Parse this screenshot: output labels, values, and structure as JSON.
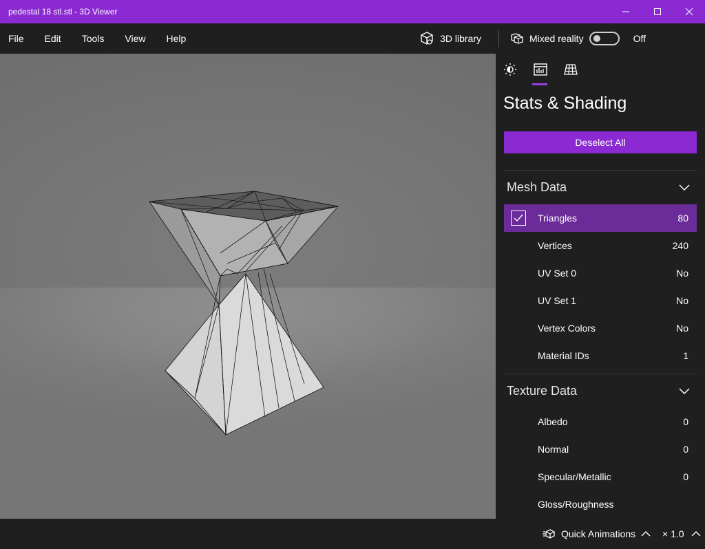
{
  "window": {
    "title": "pedestal 18 stl.stl - 3D Viewer",
    "controls": [
      "minimize",
      "maximize",
      "close"
    ]
  },
  "menu": {
    "items": [
      "File",
      "Edit",
      "Tools",
      "View",
      "Help"
    ],
    "library_label": "3D library",
    "mixed_reality_label": "Mixed reality",
    "mixed_reality_state": "Off"
  },
  "panel": {
    "tabs": [
      {
        "icon": "lighting-icon",
        "active": false
      },
      {
        "icon": "stats-icon",
        "active": true
      },
      {
        "icon": "grid-icon",
        "active": false
      }
    ],
    "title": "Stats & Shading",
    "deselect_label": "Deselect All",
    "mesh": {
      "title": "Mesh Data",
      "rows": [
        {
          "label": "Triangles",
          "value": "80",
          "selected": true
        },
        {
          "label": "Vertices",
          "value": "240"
        },
        {
          "label": "UV Set 0",
          "value": "No"
        },
        {
          "label": "UV Set 1",
          "value": "No"
        },
        {
          "label": "Vertex Colors",
          "value": "No"
        },
        {
          "label": "Material IDs",
          "value": "1"
        }
      ]
    },
    "texture": {
      "title": "Texture Data",
      "rows": [
        {
          "label": "Albedo",
          "value": "0"
        },
        {
          "label": "Normal",
          "value": "0"
        },
        {
          "label": "Specular/Metallic",
          "value": "0"
        },
        {
          "label": "Gloss/Roughness",
          "value": ""
        }
      ]
    }
  },
  "status": {
    "quick_animations": "Quick Animations",
    "speed": "× 1.0"
  },
  "colors": {
    "accent": "#8b2ad2",
    "selected_row": "#6b2b98",
    "background": "#1f1f1f"
  }
}
